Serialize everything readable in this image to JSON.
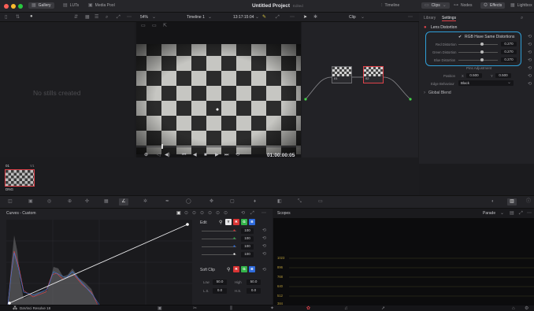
{
  "window": {
    "title": "Untitled Project",
    "subtitle": "Edited"
  },
  "topbar": {
    "tabs": [
      {
        "label": "Gallery"
      },
      {
        "label": "LUTs"
      },
      {
        "label": "Media Pool"
      }
    ],
    "right_tabs": [
      {
        "label": "Timeline"
      },
      {
        "label": "Clips"
      },
      {
        "label": "Nodes"
      },
      {
        "label": "Effects"
      },
      {
        "label": "Lightbox"
      }
    ]
  },
  "toolbar": {
    "zoom": "54%",
    "timeline": "Timeline 1",
    "timecode": "13:17:15:04",
    "clip": "Clip"
  },
  "gallery": {
    "empty_text": "No stills created"
  },
  "viewer": {
    "timecode": "01:00:00:05"
  },
  "nodes": {
    "node1": "01",
    "node2": "02"
  },
  "thumbs": {
    "clip_num": "01",
    "clip_v": "V1",
    "codec": "DNG"
  },
  "settings": {
    "tabs": {
      "library": "Library",
      "settings": "Settings"
    },
    "section": "Lens Distortion",
    "rgb_same": "RGB Have Same Distortions",
    "params": [
      {
        "label": "Red Distortion",
        "value": "0.270"
      },
      {
        "label": "Green Distortion",
        "value": "0.270"
      },
      {
        "label": "Blue Distortion",
        "value": "0.270"
      }
    ],
    "pins": "Pins Adjustment",
    "position_label": "Position",
    "x_label": "X",
    "x": "0.500",
    "y_label": "Y",
    "y": "0.500",
    "edge_label": "Edge Behaviour",
    "edge": "Black",
    "global": "Global Blend"
  },
  "curves": {
    "title": "Curves - Custom",
    "edit": "Edit",
    "channels": [
      {
        "value": "100",
        "color": "#d83434"
      },
      {
        "value": "100",
        "color": "#34b34a"
      },
      {
        "value": "100",
        "color": "#2f6bdb"
      },
      {
        "value": "100",
        "color": "#ffffff"
      }
    ],
    "softclip": "Soft Clip",
    "low_label": "Low",
    "low": "50.0",
    "high_label": "High",
    "high": "50.0",
    "ls_label": "L.S.",
    "ls": "0.0",
    "hs_label": "H.S.",
    "hs": "0.0"
  },
  "scopes": {
    "title": "Scopes",
    "mode": "Parade",
    "scale": [
      "1023",
      "896",
      "768",
      "640",
      "512",
      "384"
    ]
  },
  "app": {
    "name": "DaVinci Resolve 18"
  },
  "colors": {
    "accent": "#e0434b",
    "highlight": "#2f9fd8"
  }
}
